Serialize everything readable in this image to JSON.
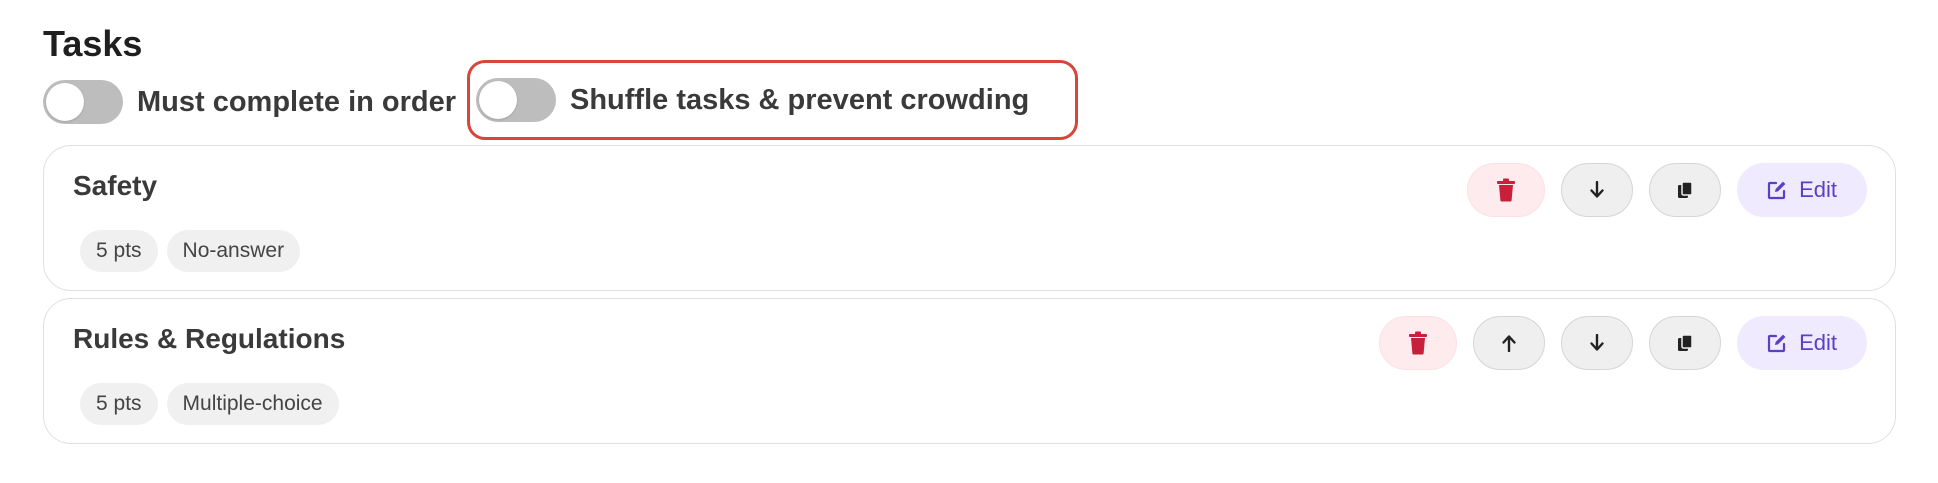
{
  "section": {
    "title": "Tasks"
  },
  "toggles": [
    {
      "label": "Must complete in order",
      "state": "off"
    },
    {
      "label": "Shuffle tasks & prevent crowding",
      "state": "off"
    }
  ],
  "tasks": [
    {
      "name": "Safety",
      "points": "5 pts",
      "type": "No-answer",
      "actions": [
        "trash-icon",
        "arrow-down-icon",
        "copy-icon",
        "edit-icon"
      ]
    },
    {
      "name": "Rules & Regulations",
      "points": "5 pts",
      "type": "Multiple-choice",
      "actions": [
        "trash-icon",
        "arrow-up-icon",
        "arrow-down-icon",
        "copy-icon",
        "edit-icon"
      ]
    }
  ],
  "labels": {
    "edit": "Edit"
  },
  "colors": {
    "delete_icon": "#c8203a",
    "edit_accent": "#5b3fc4",
    "highlight_border": "#d9443b",
    "switch_off": "#bdbdbd"
  }
}
